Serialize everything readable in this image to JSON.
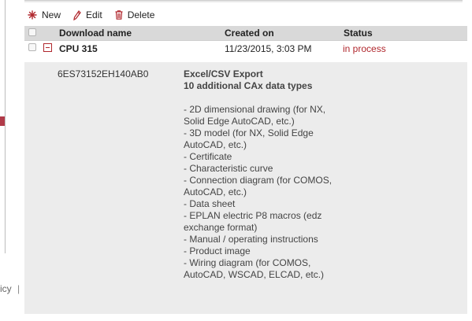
{
  "footer": {
    "fragment": "icy",
    "separator": "|"
  },
  "toolbar": {
    "new_label": "New",
    "edit_label": "Edit",
    "delete_label": "Delete"
  },
  "table": {
    "headers": {
      "name": "Download name",
      "created": "Created on",
      "status": "Status"
    },
    "row": {
      "name": "CPU 315",
      "created": "11/23/2015, 3:03 PM",
      "status": "in process"
    },
    "detail": {
      "part_number": "6ES73152EH140AB0",
      "format": "Excel/CSV Export",
      "count_text": "10 additional CAx data types",
      "items": [
        "- 2D dimensional drawing (for NX, Solid Edge AutoCAD, etc.)",
        "- 3D model (for NX, Solid Edge AutoCAD, etc.)",
        "- Certificate",
        "- Characteristic curve",
        "- Connection diagram (for COMOS, AutoCAD, etc.)",
        "- Data sheet",
        "- EPLAN electric P8 macros (edz exchange format)",
        "- Manual / operating instructions",
        "- Product image",
        "- Wiring diagram (for COMOS, AutoCAD, WSCAD, ELCAD, etc.)"
      ]
    }
  },
  "colors": {
    "accent": "#b0272d",
    "header_bg": "#d9d9d9",
    "detail_bg": "#ececec"
  },
  "icons": {
    "new": "asterisk-icon",
    "edit": "pencil-icon",
    "delete": "trash-icon",
    "expand": "minus-box-icon"
  }
}
